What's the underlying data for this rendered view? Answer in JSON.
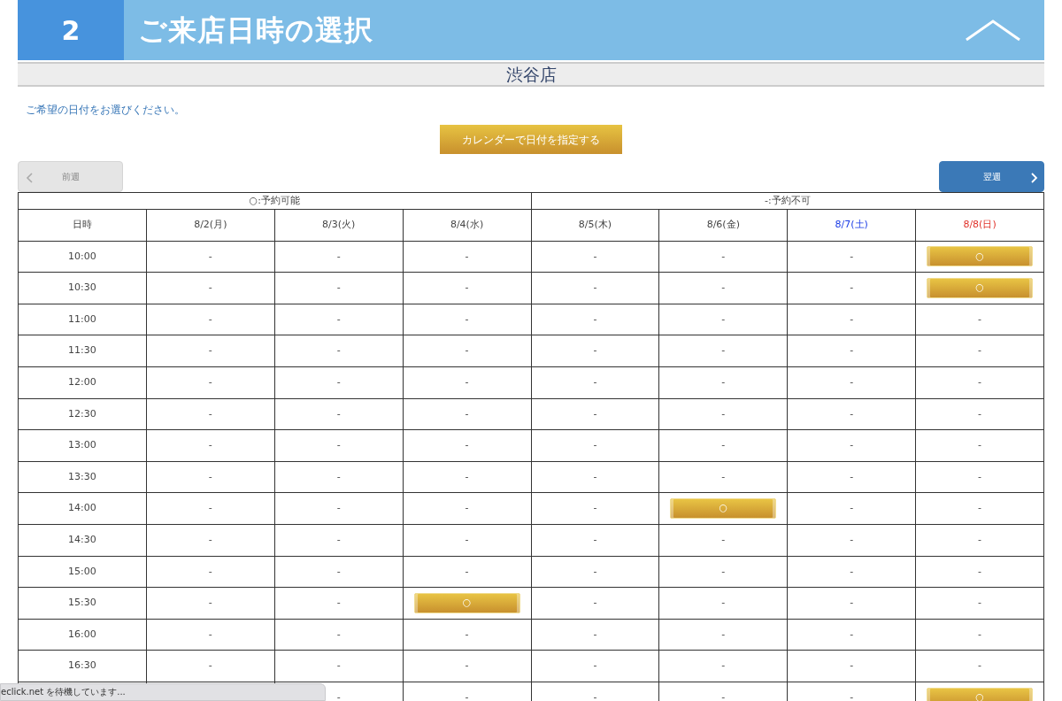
{
  "header": {
    "step": "2",
    "title": "ご来店日時の選択"
  },
  "store": "渋谷店",
  "instruction": "ご希望の日付をお選びください。",
  "calendar_button": "カレンダーで日付を指定する",
  "prev_week": {
    "label": "前週",
    "disabled": true
  },
  "next_week": {
    "label": "翌週",
    "disabled": false
  },
  "legend": {
    "available": "○:予約可能",
    "unavailable": "-:予約不可"
  },
  "time_heading": "日時",
  "days": [
    {
      "label": "8/2(月)",
      "kind": "weekday"
    },
    {
      "label": "8/3(火)",
      "kind": "weekday"
    },
    {
      "label": "8/4(水)",
      "kind": "weekday"
    },
    {
      "label": "8/5(木)",
      "kind": "weekday"
    },
    {
      "label": "8/6(金)",
      "kind": "weekday"
    },
    {
      "label": "8/7(土)",
      "kind": "saturday"
    },
    {
      "label": "8/8(日)",
      "kind": "sunday"
    }
  ],
  "rows": [
    {
      "time": "10:00",
      "cells": [
        {
          "kind": "unavailable",
          "text": "-"
        },
        {
          "kind": "unavailable",
          "text": "-"
        },
        {
          "kind": "unavailable",
          "text": "-"
        },
        {
          "kind": "unavailable",
          "text": "-"
        },
        {
          "kind": "unavailable",
          "text": "-"
        },
        {
          "kind": "unavailable",
          "text": "-"
        },
        {
          "kind": "available",
          "text": "○"
        }
      ]
    },
    {
      "time": "10:30",
      "cells": [
        {
          "kind": "unavailable",
          "text": "-"
        },
        {
          "kind": "unavailable",
          "text": "-"
        },
        {
          "kind": "unavailable",
          "text": "-"
        },
        {
          "kind": "unavailable",
          "text": "-"
        },
        {
          "kind": "unavailable",
          "text": "-"
        },
        {
          "kind": "unavailable",
          "text": "-"
        },
        {
          "kind": "available",
          "text": "○"
        }
      ]
    },
    {
      "time": "11:00",
      "cells": [
        {
          "kind": "unavailable",
          "text": "-"
        },
        {
          "kind": "unavailable",
          "text": "-"
        },
        {
          "kind": "unavailable",
          "text": "-"
        },
        {
          "kind": "unavailable",
          "text": "-"
        },
        {
          "kind": "unavailable",
          "text": "-"
        },
        {
          "kind": "unavailable",
          "text": "-"
        },
        {
          "kind": "unavailable",
          "text": "-"
        }
      ]
    },
    {
      "time": "11:30",
      "cells": [
        {
          "kind": "unavailable",
          "text": "-"
        },
        {
          "kind": "unavailable",
          "text": "-"
        },
        {
          "kind": "unavailable",
          "text": "-"
        },
        {
          "kind": "unavailable",
          "text": "-"
        },
        {
          "kind": "unavailable",
          "text": "-"
        },
        {
          "kind": "unavailable",
          "text": "-"
        },
        {
          "kind": "unavailable",
          "text": "-"
        }
      ]
    },
    {
      "time": "12:00",
      "cells": [
        {
          "kind": "unavailable",
          "text": "-"
        },
        {
          "kind": "unavailable",
          "text": "-"
        },
        {
          "kind": "unavailable",
          "text": "-"
        },
        {
          "kind": "unavailable",
          "text": "-"
        },
        {
          "kind": "unavailable",
          "text": "-"
        },
        {
          "kind": "unavailable",
          "text": "-"
        },
        {
          "kind": "unavailable",
          "text": "-"
        }
      ]
    },
    {
      "time": "12:30",
      "cells": [
        {
          "kind": "unavailable",
          "text": "-"
        },
        {
          "kind": "unavailable",
          "text": "-"
        },
        {
          "kind": "unavailable",
          "text": "-"
        },
        {
          "kind": "unavailable",
          "text": "-"
        },
        {
          "kind": "unavailable",
          "text": "-"
        },
        {
          "kind": "unavailable",
          "text": "-"
        },
        {
          "kind": "unavailable",
          "text": "-"
        }
      ]
    },
    {
      "time": "13:00",
      "cells": [
        {
          "kind": "unavailable",
          "text": "-"
        },
        {
          "kind": "unavailable",
          "text": "-"
        },
        {
          "kind": "unavailable",
          "text": "-"
        },
        {
          "kind": "unavailable",
          "text": "-"
        },
        {
          "kind": "unavailable",
          "text": "-"
        },
        {
          "kind": "unavailable",
          "text": "-"
        },
        {
          "kind": "unavailable",
          "text": "-"
        }
      ]
    },
    {
      "time": "13:30",
      "cells": [
        {
          "kind": "unavailable",
          "text": "-"
        },
        {
          "kind": "unavailable",
          "text": "-"
        },
        {
          "kind": "unavailable",
          "text": "-"
        },
        {
          "kind": "unavailable",
          "text": "-"
        },
        {
          "kind": "unavailable",
          "text": "-"
        },
        {
          "kind": "unavailable",
          "text": "-"
        },
        {
          "kind": "unavailable",
          "text": "-"
        }
      ]
    },
    {
      "time": "14:00",
      "cells": [
        {
          "kind": "unavailable",
          "text": "-"
        },
        {
          "kind": "unavailable",
          "text": "-"
        },
        {
          "kind": "unavailable",
          "text": "-"
        },
        {
          "kind": "unavailable",
          "text": "-"
        },
        {
          "kind": "available",
          "text": "○"
        },
        {
          "kind": "unavailable",
          "text": "-"
        },
        {
          "kind": "unavailable",
          "text": "-"
        }
      ]
    },
    {
      "time": "14:30",
      "cells": [
        {
          "kind": "unavailable",
          "text": "-"
        },
        {
          "kind": "unavailable",
          "text": "-"
        },
        {
          "kind": "unavailable",
          "text": "-"
        },
        {
          "kind": "unavailable",
          "text": "-"
        },
        {
          "kind": "unavailable",
          "text": "-"
        },
        {
          "kind": "unavailable",
          "text": "-"
        },
        {
          "kind": "unavailable",
          "text": "-"
        }
      ]
    },
    {
      "time": "15:00",
      "cells": [
        {
          "kind": "unavailable",
          "text": "-"
        },
        {
          "kind": "unavailable",
          "text": "-"
        },
        {
          "kind": "unavailable",
          "text": "-"
        },
        {
          "kind": "unavailable",
          "text": "-"
        },
        {
          "kind": "unavailable",
          "text": "-"
        },
        {
          "kind": "unavailable",
          "text": "-"
        },
        {
          "kind": "unavailable",
          "text": "-"
        }
      ]
    },
    {
      "time": "15:30",
      "cells": [
        {
          "kind": "unavailable",
          "text": "-"
        },
        {
          "kind": "unavailable",
          "text": "-"
        },
        {
          "kind": "available",
          "text": "○"
        },
        {
          "kind": "unavailable",
          "text": "-"
        },
        {
          "kind": "unavailable",
          "text": "-"
        },
        {
          "kind": "unavailable",
          "text": "-"
        },
        {
          "kind": "unavailable",
          "text": "-"
        }
      ]
    },
    {
      "time": "16:00",
      "cells": [
        {
          "kind": "unavailable",
          "text": "-"
        },
        {
          "kind": "unavailable",
          "text": "-"
        },
        {
          "kind": "unavailable",
          "text": "-"
        },
        {
          "kind": "unavailable",
          "text": "-"
        },
        {
          "kind": "unavailable",
          "text": "-"
        },
        {
          "kind": "unavailable",
          "text": "-"
        },
        {
          "kind": "unavailable",
          "text": "-"
        }
      ]
    },
    {
      "time": "16:30",
      "cells": [
        {
          "kind": "unavailable",
          "text": "-"
        },
        {
          "kind": "unavailable",
          "text": "-"
        },
        {
          "kind": "unavailable",
          "text": "-"
        },
        {
          "kind": "unavailable",
          "text": "-"
        },
        {
          "kind": "unavailable",
          "text": "-"
        },
        {
          "kind": "unavailable",
          "text": "-"
        },
        {
          "kind": "unavailable",
          "text": "-"
        }
      ]
    },
    {
      "cells": [
        {
          "kind": "covered"
        },
        {
          "kind": "unavailable",
          "text": "-"
        },
        {
          "kind": "unavailable",
          "text": "-"
        },
        {
          "kind": "unavailable",
          "text": "-"
        },
        {
          "kind": "unavailable",
          "text": "-"
        },
        {
          "kind": "unavailable",
          "text": "-"
        },
        {
          "kind": "available",
          "text": "○"
        }
      ]
    }
  ],
  "status_bar": "eclick.net を待機しています..."
}
